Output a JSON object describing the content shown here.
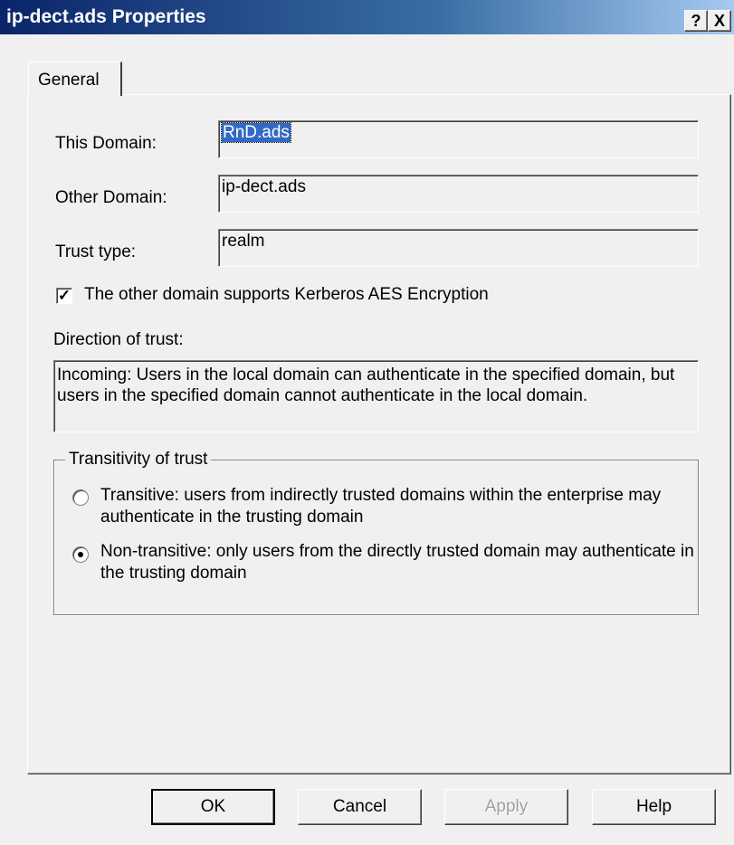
{
  "window": {
    "title": "ip-dect.ads Properties"
  },
  "titlebar_buttons": {
    "help": "?",
    "close": "X"
  },
  "tabs": [
    {
      "label": "General"
    }
  ],
  "fields": {
    "this_domain": {
      "label": "This Domain:",
      "value": "RnD.ads"
    },
    "other_domain": {
      "label": "Other Domain:",
      "value": "ip-dect.ads"
    },
    "trust_type": {
      "label": "Trust type:",
      "value": "realm"
    }
  },
  "aes_checkbox": {
    "label": "The other domain supports Kerberos AES Encryption",
    "checked": true,
    "check_glyph": "✓"
  },
  "direction": {
    "label": "Direction of trust:",
    "text": "Incoming: Users in the local domain can authenticate in the specified domain, but users in the specified domain cannot authenticate in the local domain."
  },
  "transitivity": {
    "legend": "Transitivity of trust",
    "options": [
      {
        "label": "Transitive: users from indirectly trusted domains within the enterprise may authenticate in the trusting domain",
        "selected": false
      },
      {
        "label": "Non-transitive: only users from the directly trusted domain may authenticate in the trusting domain",
        "selected": true
      }
    ]
  },
  "buttons": {
    "ok": "OK",
    "cancel": "Cancel",
    "apply": "Apply",
    "help": "Help"
  }
}
